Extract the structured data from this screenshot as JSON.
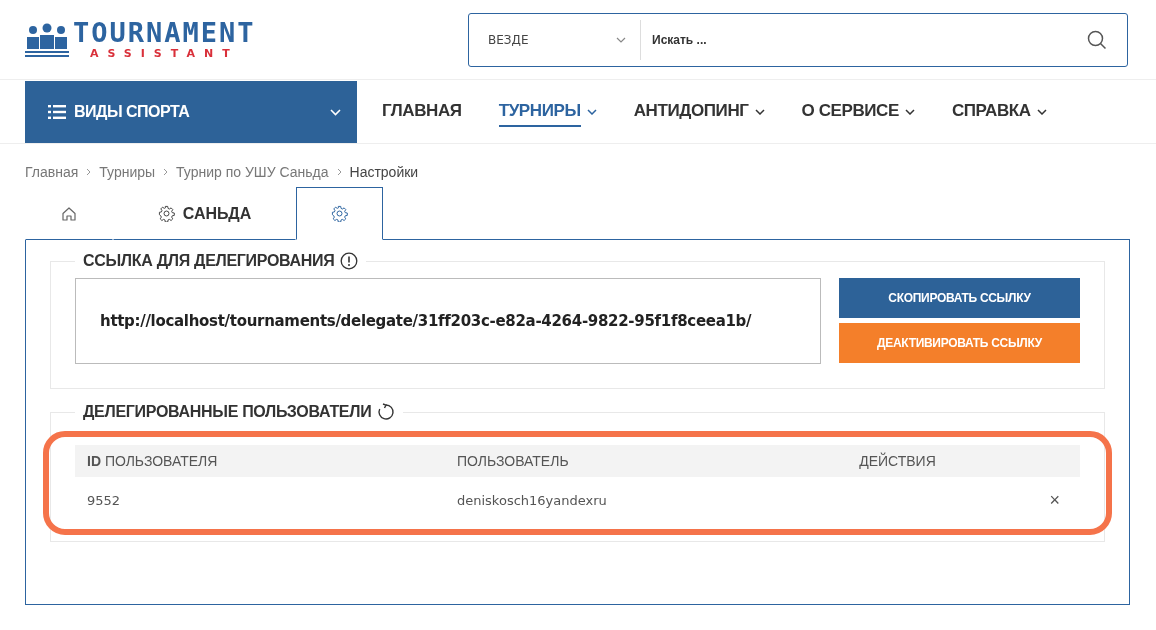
{
  "logo": {
    "title": "TOURNAMENT",
    "subtitle": "ASSISTANT"
  },
  "search": {
    "scope": "ВЕЗДЕ",
    "placeholder": "Искать ..."
  },
  "sports_menu": {
    "label": "ВИДЫ СПОРТА"
  },
  "nav": [
    {
      "label": "ГЛАВНАЯ",
      "selected": false,
      "dropdown": false
    },
    {
      "label": "ТУРНИРЫ",
      "selected": true,
      "dropdown": true
    },
    {
      "label": "АНТИДОПИНГ",
      "selected": false,
      "dropdown": true
    },
    {
      "label": "О СЕРВИСЕ",
      "selected": false,
      "dropdown": true
    },
    {
      "label": "СПРАВКА",
      "selected": false,
      "dropdown": true
    }
  ],
  "breadcrumbs": [
    "Главная",
    "Турниры",
    "Турнир по УШУ Саньда",
    "Настройки"
  ],
  "tabs": [
    {
      "kind": "home",
      "selected": false
    },
    {
      "kind": "gear",
      "label": "САНЬДА",
      "selected": false
    },
    {
      "kind": "gear",
      "selected": true
    }
  ],
  "delegation": {
    "title": "ССЫЛКА ДЛЯ ДЕЛЕГИРОВАНИЯ",
    "link": "http://localhost/tournaments/delegate/31ff203c-e82a-4264-9822-95f1f8ceea1b/",
    "buttons": [
      {
        "label": "СКОПИРОВАТЬ ССЫЛКУ",
        "kind": "primary"
      },
      {
        "label": "ДЕАКТИВИРОВАТЬ ССЫЛКУ",
        "kind": "warning"
      }
    ]
  },
  "users": {
    "title": "ДЕЛЕГИРОВАННЫЕ ПОЛЬЗОВАТЕЛИ",
    "columns": [
      "**ID** ПОЛЬЗОВАТЕЛЯ",
      "ПОЛЬЗОВАТЕЛЬ",
      "ДЕЙСТВИЯ"
    ],
    "rows": [
      {
        "id": "9552",
        "user": "deniskosch16yandexru",
        "action": "×"
      }
    ]
  }
}
